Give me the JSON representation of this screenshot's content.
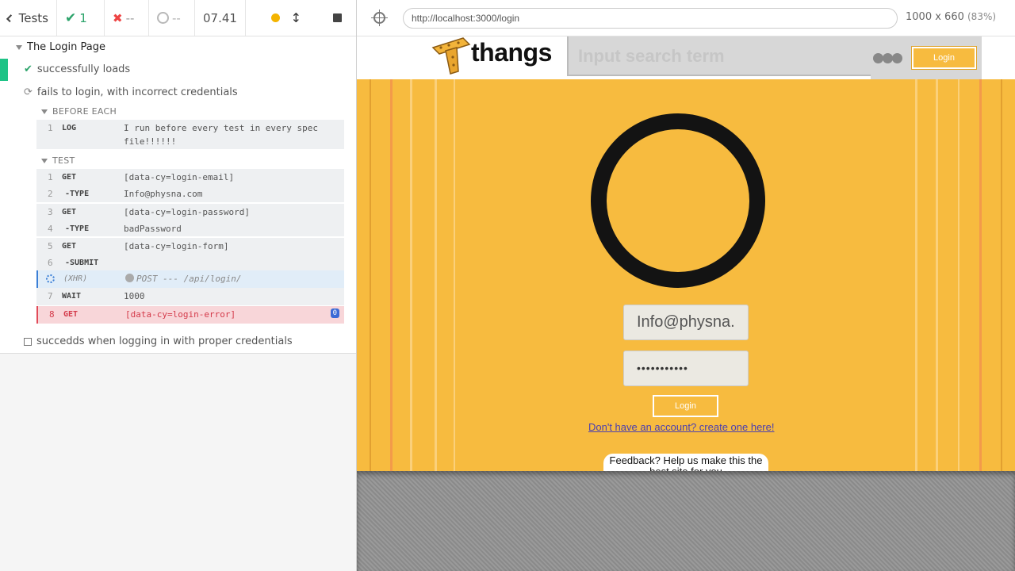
{
  "reporter": {
    "header": {
      "tests_label": "Tests",
      "passed_count": "1",
      "failed_count": "--",
      "pending_count": "--",
      "duration": "07.41"
    },
    "suite": {
      "title": "The Login Page",
      "tests": [
        {
          "title": "successfully loads",
          "state": "passed"
        },
        {
          "title": "fails to login, with incorrect credentials",
          "state": "running"
        },
        {
          "title": "succedds when logging in with proper credentials",
          "state": "pending"
        }
      ]
    },
    "hooks": {
      "before_each": {
        "title": "BEFORE EACH",
        "commands": [
          {
            "num": "1",
            "name": "LOG",
            "msg": "I run before every test in every spec",
            "msg2": "file!!!!!!"
          }
        ]
      },
      "test": {
        "title": "TEST",
        "commands": [
          {
            "num": "1",
            "name": "GET",
            "msg": "[data-cy=login-email]"
          },
          {
            "num": "2",
            "name": "-TYPE",
            "msg": "Info@physna.com"
          },
          {
            "num": "3",
            "name": "GET",
            "msg": "[data-cy=login-password]"
          },
          {
            "num": "4",
            "name": "-TYPE",
            "msg": "badPassword"
          },
          {
            "num": "5",
            "name": "GET",
            "msg": "[data-cy=login-form]"
          },
          {
            "num": "6",
            "name": "-SUBMIT",
            "msg": ""
          },
          {
            "num": "",
            "name": "(XHR)",
            "msg": "POST --- /api/login/"
          },
          {
            "num": "7",
            "name": "WAIT",
            "msg": "1000"
          },
          {
            "num": "8",
            "name": "GET",
            "msg": "[data-cy=login-error]",
            "badge": "0"
          }
        ]
      }
    }
  },
  "aut": {
    "url": "http://localhost:3000/login",
    "viewport": "1000 x 660",
    "scale": "(83%)",
    "site": {
      "brand": "thangs",
      "search_placeholder": "Input search term",
      "nav_login": "Login",
      "email_value": "Info@physna.",
      "password_value": "•••••••••••",
      "login_button": "Login",
      "signup_link": "Don't have an account? create one here!",
      "feedback": "Feedback? Help us make this the best site for you"
    },
    "colors": {
      "accent": "#f7bb3f",
      "passed": "#1ec386",
      "error": "#e14b59"
    }
  }
}
